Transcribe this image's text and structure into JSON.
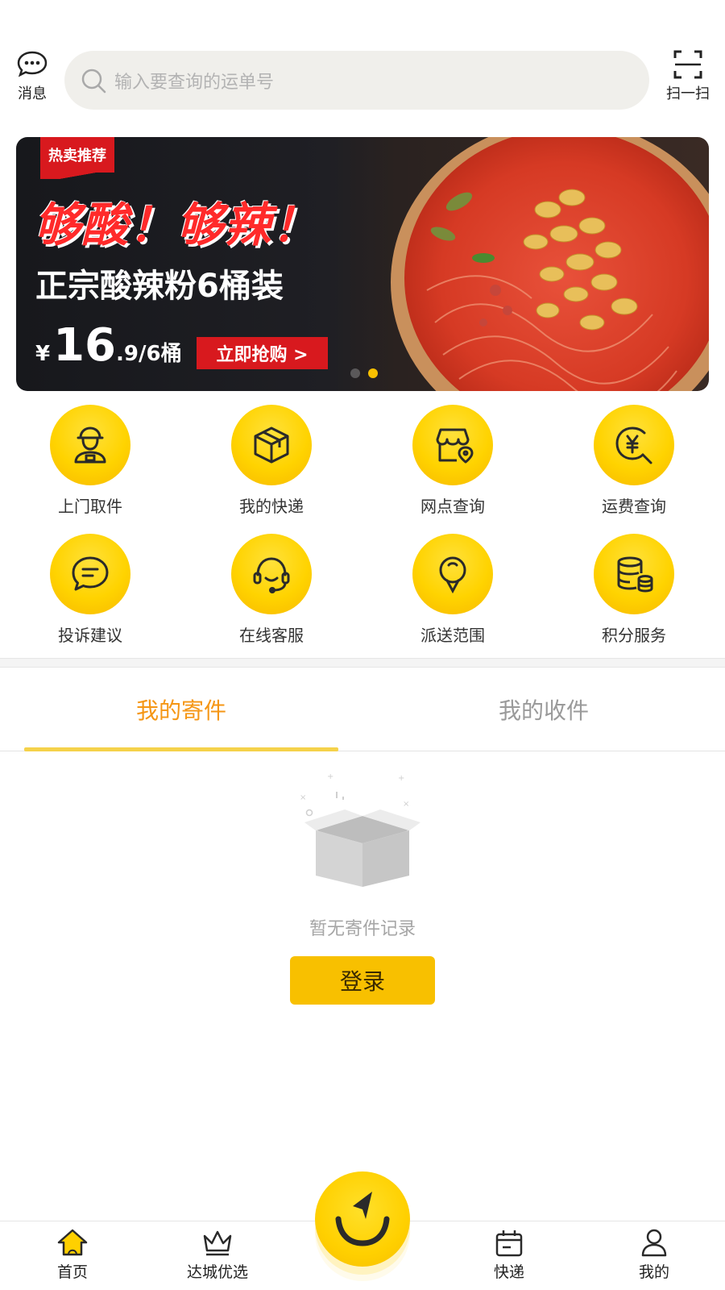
{
  "header": {
    "message_label": "消息",
    "search_placeholder": "输入要查询的运单号",
    "scan_label": "扫一扫"
  },
  "banner": {
    "tag": "热卖推荐",
    "headline": "够酸！够辣！",
    "subline": "正宗酸辣粉6桶装",
    "price_currency": "¥",
    "price_main": "16",
    "price_rest": ".9/6桶",
    "cta": "立即抢购 >",
    "slides_total": 2,
    "active_slide_index": 1
  },
  "services": [
    {
      "label": "上门取件",
      "icon": "courier-icon"
    },
    {
      "label": "我的快递",
      "icon": "package-icon"
    },
    {
      "label": "网点查询",
      "icon": "store-location-icon"
    },
    {
      "label": "运费查询",
      "icon": "yuan-search-icon"
    },
    {
      "label": "投诉建议",
      "icon": "chat-bubble-icon"
    },
    {
      "label": "在线客服",
      "icon": "headset-icon"
    },
    {
      "label": "派送范围",
      "icon": "map-pin-icon"
    },
    {
      "label": "积分服务",
      "icon": "coins-icon"
    }
  ],
  "tabs": {
    "send": "我的寄件",
    "receive": "我的收件",
    "active": "send"
  },
  "empty_state": {
    "text": "暂无寄件记录",
    "login_button": "登录"
  },
  "bottom_nav": {
    "items": [
      {
        "label": "首页",
        "icon": "home-icon"
      },
      {
        "label": "达城优选",
        "icon": "crown-icon"
      },
      {
        "label": "快递",
        "icon": "delivery-box-icon"
      },
      {
        "label": "我的",
        "icon": "user-icon"
      }
    ],
    "center_icon": "send-smile-icon"
  },
  "colors": {
    "accent_yellow": "#f8c000",
    "active_tab": "#f59614",
    "banner_red": "#d8191e"
  }
}
